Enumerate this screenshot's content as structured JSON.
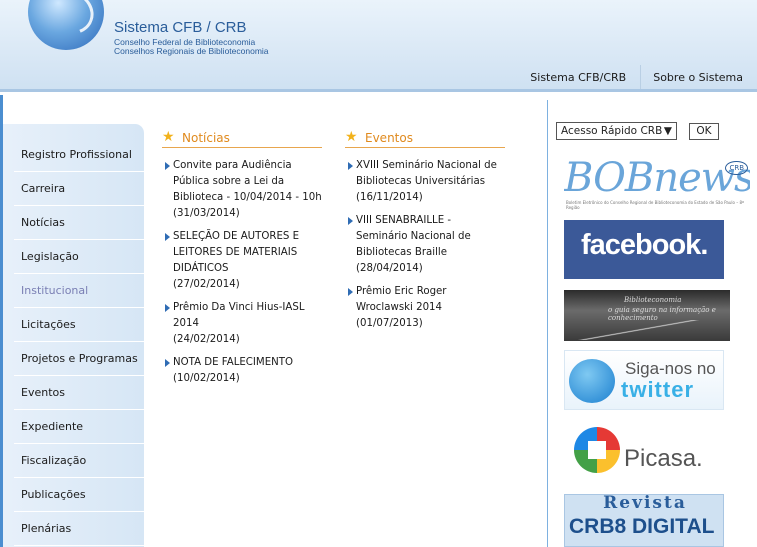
{
  "header": {
    "title": "Sistema CFB / CRB",
    "sub1": "Conselho Federal de Biblioteconomia",
    "sub2": "Conselhos Regionais de Biblioteconomia",
    "nav": [
      "Sistema CFB/CRB",
      "Sobre o Sistema"
    ]
  },
  "sidebar": {
    "items": [
      {
        "label": "Registro Profissional"
      },
      {
        "label": "Carreira"
      },
      {
        "label": "Notícias"
      },
      {
        "label": "Legislação"
      },
      {
        "label": "Institucional"
      },
      {
        "label": "Licitações"
      },
      {
        "label": "Projetos e Programas"
      },
      {
        "label": "Eventos"
      },
      {
        "label": "Expediente"
      },
      {
        "label": "Fiscalização"
      },
      {
        "label": "Publicações"
      },
      {
        "label": "Plenárias"
      }
    ],
    "active_index": 4
  },
  "noticias": {
    "title": "Notícias",
    "items": [
      {
        "text": "Convite para Audiência Pública sobre a Lei da Biblioteca - 10/04/2014 - 10h",
        "date": "(31/03/2014)"
      },
      {
        "text": "SELEÇÃO DE AUTORES E LEITORES DE MATERIAIS DIDÁTICOS",
        "date": "(27/02/2014)"
      },
      {
        "text": "Prêmio Da Vinci Hius-IASL 2014",
        "date": "(24/02/2014)"
      },
      {
        "text": "NOTA DE FALECIMENTO",
        "date": "(10/02/2014)"
      }
    ]
  },
  "eventos": {
    "title": "Eventos",
    "items": [
      {
        "text": "XVIII Seminário Nacional de Bibliotecas Universitárias",
        "date": "(16/11/2014)"
      },
      {
        "text": "VIII SENABRAILLE - Seminário Nacional de Bibliotecas Braille",
        "date": "(28/04/2014)"
      },
      {
        "text": "Prêmio Eric Roger Wroclawski 2014",
        "date": "(01/07/2013)"
      }
    ]
  },
  "quick_access": {
    "selected": "Acesso Rápido CRB",
    "button": "OK"
  },
  "banners": {
    "bobnews": "BOBnews",
    "bobnews_small": "Boletim Eletrônico do Conselho Regional de Biblioteconomia do Estado de São Paulo – 8ª Região",
    "bobnews_badge": "CRB",
    "facebook": "facebook.",
    "road_line1": "Biblioteconomia",
    "road_line2": "o guia seguro na informação e conhecimento",
    "twitter_line1": "Siga-nos no",
    "twitter_line2": "twitter",
    "picasa": "Picasa.",
    "revista_line1": "Revista",
    "revista_line2": "CRB8 DIGITAL"
  },
  "colors": {
    "accent_orange": "#e08a1e",
    "nav_blue": "#2a5d9a",
    "facebook_blue": "#3b5998",
    "active_item": "#7a7fb4"
  }
}
